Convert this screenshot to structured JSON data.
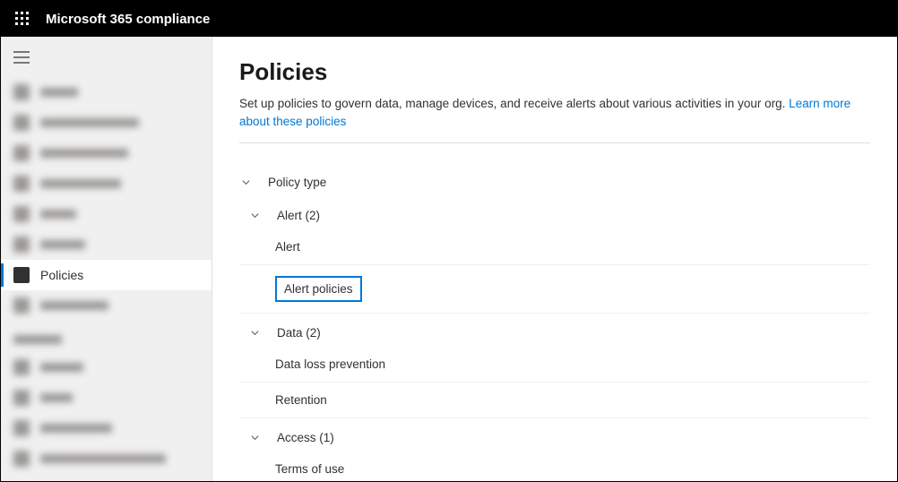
{
  "app_title": "Microsoft 365 compliance",
  "sidebar": {
    "active_item": {
      "label": "Policies"
    },
    "blurred_widths": [
      42,
      110,
      98,
      90,
      40,
      50,
      76
    ],
    "heading_width": 54,
    "blurred_widths_2": [
      48,
      36,
      80,
      140
    ]
  },
  "page": {
    "title": "Policies",
    "description": "Set up policies to govern data, manage devices, and receive alerts about various activities in your org. ",
    "learn_more": "Learn more about these policies"
  },
  "groups": [
    {
      "header": "Policy type",
      "items": [],
      "indent": false
    },
    {
      "header": "Alert (2)",
      "items": [
        {
          "label": "Alert",
          "highlighted": false
        },
        {
          "label": "Alert policies",
          "highlighted": true
        }
      ]
    },
    {
      "header": "Data (2)",
      "items": [
        {
          "label": "Data loss prevention",
          "highlighted": false
        },
        {
          "label": "Retention",
          "highlighted": false
        }
      ]
    },
    {
      "header": "Access (1)",
      "items": [
        {
          "label": "Terms of use",
          "highlighted": false
        }
      ]
    }
  ]
}
